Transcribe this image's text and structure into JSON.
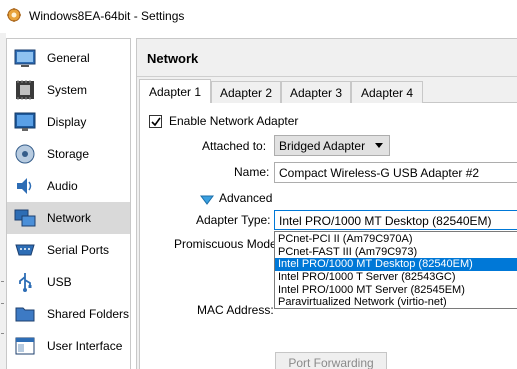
{
  "window": {
    "title": "Windows8EA-64bit - Settings",
    "icon": "virtualbox-icon"
  },
  "sidebar": {
    "selected_index": 5,
    "items": [
      {
        "label": "General",
        "icon": "general-icon"
      },
      {
        "label": "System",
        "icon": "system-icon"
      },
      {
        "label": "Display",
        "icon": "display-icon"
      },
      {
        "label": "Storage",
        "icon": "storage-icon"
      },
      {
        "label": "Audio",
        "icon": "audio-icon"
      },
      {
        "label": "Network",
        "icon": "network-icon"
      },
      {
        "label": "Serial Ports",
        "icon": "serial-ports-icon"
      },
      {
        "label": "USB",
        "icon": "usb-icon"
      },
      {
        "label": "Shared Folders",
        "icon": "shared-folders-icon"
      },
      {
        "label": "User Interface",
        "icon": "user-interface-icon"
      }
    ]
  },
  "panel": {
    "title": "Network"
  },
  "tabs": [
    {
      "label": "Adapter 1",
      "active": true
    },
    {
      "label": "Adapter 2",
      "active": false
    },
    {
      "label": "Adapter 3",
      "active": false
    },
    {
      "label": "Adapter 4",
      "active": false
    }
  ],
  "form": {
    "enable_label": "Enable Network Adapter",
    "enable_checked": true,
    "attached_label": "Attached to:",
    "attached_value": "Bridged Adapter",
    "name_label": "Name:",
    "name_value": "Compact Wireless-G USB Adapter #2",
    "advanced_label": "Advanced",
    "adapter_type_label": "Adapter Type:",
    "adapter_type_value": "Intel PRO/1000 MT Desktop (82540EM)",
    "promiscuous_label": "Promiscuous Mode:",
    "mac_label": "MAC Address:",
    "port_forwarding_label": "Port Forwarding"
  },
  "adapter_type_options": [
    "PCnet-PCI II (Am79C970A)",
    "PCnet-FAST III (Am79C973)",
    "Intel PRO/1000 MT Desktop (82540EM)",
    "Intel PRO/1000 T Server (82543GC)",
    "Intel PRO/1000 MT Server (82545EM)",
    "Paravirtualized Network (virtio-net)"
  ],
  "adapter_type_highlighted_index": 2,
  "colors": {
    "selection": "#0078d7",
    "sidebar_selected": "#d9d9d9",
    "panel_bg": "#f0f0f0"
  }
}
